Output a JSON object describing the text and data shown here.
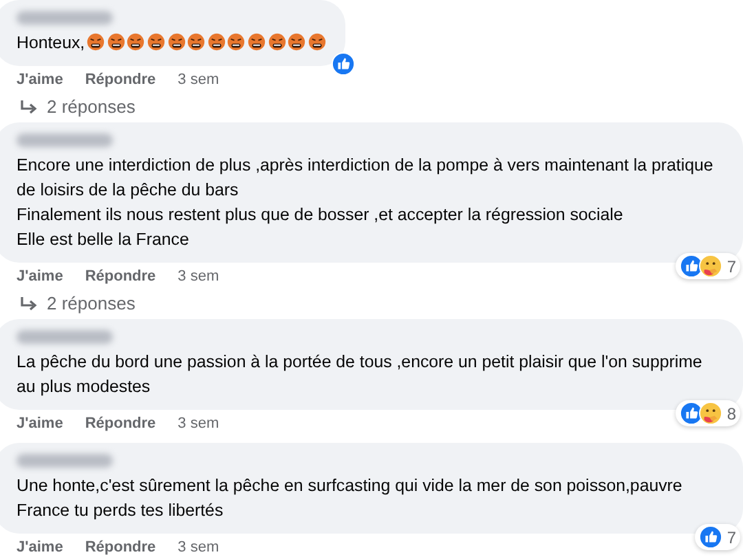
{
  "comments": [
    {
      "lines": [
        "Honteux,"
      ],
      "emojis": [
        {
          "kind": "cursing"
        },
        {
          "kind": "cursing"
        },
        {
          "kind": "cursing"
        },
        {
          "kind": "cursing"
        },
        {
          "kind": "cursing"
        },
        {
          "kind": "cursing"
        },
        {
          "kind": "cursing"
        },
        {
          "kind": "cursing"
        },
        {
          "kind": "cursing"
        },
        {
          "kind": "cursing"
        },
        {
          "kind": "cursing"
        },
        {
          "kind": "cursing"
        }
      ],
      "reactions": [
        {
          "kind": "like"
        }
      ],
      "actions": [
        "J'aime",
        "Répondre"
      ],
      "time": "3 sem",
      "replies": "2 réponses"
    },
    {
      "lines": [
        "Encore une interdiction de plus ,après interdiction de la pompe à vers maintenant la pratique de loisirs de la pêche du bars",
        "Finalement ils nous restent plus que de bosser ,et accepter la régression sociale",
        "Elle est belle la France"
      ],
      "reactions": [
        {
          "kind": "like"
        },
        {
          "kind": "care"
        }
      ],
      "count": "7",
      "actions": [
        "J'aime",
        "Répondre"
      ],
      "time": "3 sem",
      "replies": "2 réponses"
    },
    {
      "lines": [
        "La pêche du bord une passion à la portée de tous ,encore un petit plaisir que l'on supprime au plus modestes"
      ],
      "reactions": [
        {
          "kind": "like"
        },
        {
          "kind": "care"
        }
      ],
      "count": "8",
      "actions": [
        "J'aime",
        "Répondre"
      ],
      "time": "3 sem"
    },
    {
      "lines": [
        "Une honte,c'est sûrement la pêche en surfcasting qui vide la mer de son poisson,pauvre France tu perds tes libertés"
      ],
      "reactions": [
        {
          "kind": "like"
        }
      ],
      "count": "7",
      "actions": [
        "J'aime",
        "Répondre"
      ],
      "time": "3 sem"
    }
  ]
}
